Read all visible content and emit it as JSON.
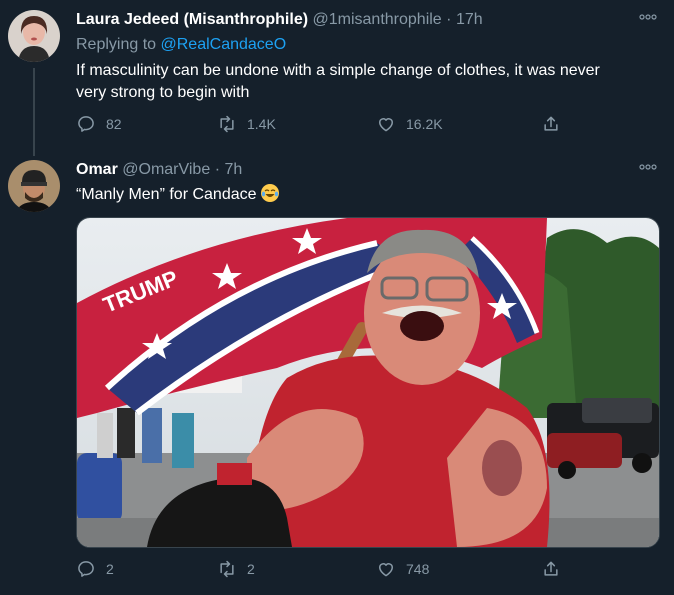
{
  "tweet1": {
    "name": "Laura Jedeed (Misanthrophile)",
    "handle": "@1misanthrophile",
    "separator": "·",
    "time": "17h",
    "replying_prefix": "Replying to",
    "replying_handle": "@RealCandaceO",
    "text_line1": "If masculinity can be undone with a simple change of clothes, it was never",
    "text_line2": "very strong to begin with",
    "replies": "82",
    "retweets": "1.4K",
    "likes": "16.2K"
  },
  "tweet2": {
    "name": "Omar",
    "handle": "@OmarVibe",
    "separator": "·",
    "time": "7h",
    "text": "“Manly Men” for Candace",
    "replies": "2",
    "retweets": "2",
    "likes": "748",
    "media": {
      "flag_text": "TRUMP"
    }
  },
  "colors": {
    "background": "#15202b",
    "muted": "#8899a6",
    "link": "#1da1f2",
    "divider": "#38444d"
  },
  "icons": [
    "more-icon",
    "reply-icon",
    "retweet-icon",
    "like-icon",
    "share-icon",
    "tears-of-joy-emoji-icon"
  ]
}
